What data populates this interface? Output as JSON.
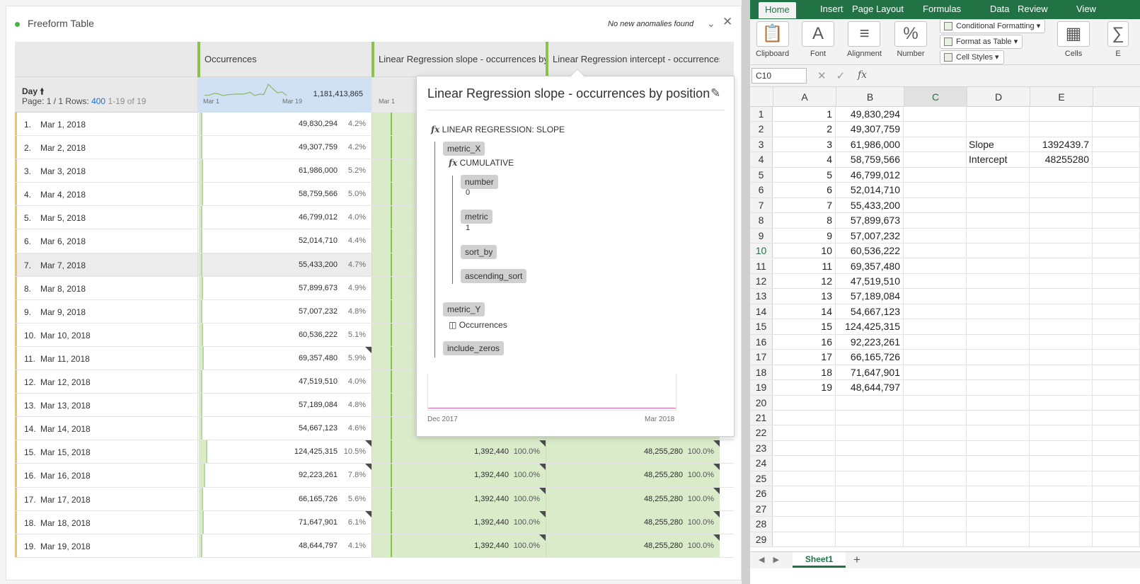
{
  "panel": {
    "title": "Freeform Table",
    "anomaly_text": "No new anomalies found",
    "collapse_icon": "chevron-down-icon",
    "close_icon": "close-icon"
  },
  "table": {
    "columns": [
      "Occurrences",
      "Linear Regression slope - occurrences by p",
      "Linear Regression intercept - occurrences b"
    ],
    "dimension": "Day",
    "sort_icon": "arrow-up-icon",
    "page_prefix": "Page: 1 / 1  Rows:",
    "rows_value": "400",
    "range_text": "1-19 of 19",
    "occ_total": "1,181,413,865",
    "spark_start": "Mar 1",
    "spark_end": "Mar 19",
    "spark2_start": "Mar 1",
    "rows": [
      {
        "idx": "1.",
        "day": "Mar 1, 2018",
        "occ": "49,830,294",
        "pct": "4.2%",
        "share": 4.2
      },
      {
        "idx": "2.",
        "day": "Mar 2, 2018",
        "occ": "49,307,759",
        "pct": "4.2%",
        "share": 4.2
      },
      {
        "idx": "3.",
        "day": "Mar 3, 2018",
        "occ": "61,986,000",
        "pct": "5.2%",
        "share": 5.2
      },
      {
        "idx": "4.",
        "day": "Mar 4, 2018",
        "occ": "58,759,566",
        "pct": "5.0%",
        "share": 5.0
      },
      {
        "idx": "5.",
        "day": "Mar 5, 2018",
        "occ": "46,799,012",
        "pct": "4.0%",
        "share": 4.0
      },
      {
        "idx": "6.",
        "day": "Mar 6, 2018",
        "occ": "52,014,710",
        "pct": "4.4%",
        "share": 4.4
      },
      {
        "idx": "7.",
        "day": "Mar 7, 2018",
        "occ": "55,433,200",
        "pct": "4.7%",
        "share": 4.7
      },
      {
        "idx": "8.",
        "day": "Mar 8, 2018",
        "occ": "57,899,673",
        "pct": "4.9%",
        "share": 4.9
      },
      {
        "idx": "9.",
        "day": "Mar 9, 2018",
        "occ": "57,007,232",
        "pct": "4.8%",
        "share": 4.8
      },
      {
        "idx": "10.",
        "day": "Mar 10, 2018",
        "occ": "60,536,222",
        "pct": "5.1%",
        "share": 5.1
      },
      {
        "idx": "11.",
        "day": "Mar 11, 2018",
        "occ": "69,357,480",
        "pct": "5.9%",
        "share": 5.9
      },
      {
        "idx": "12.",
        "day": "Mar 12, 2018",
        "occ": "47,519,510",
        "pct": "4.0%",
        "share": 4.0
      },
      {
        "idx": "13.",
        "day": "Mar 13, 2018",
        "occ": "57,189,084",
        "pct": "4.8%",
        "share": 4.8
      },
      {
        "idx": "14.",
        "day": "Mar 14, 2018",
        "occ": "54,667,123",
        "pct": "4.6%",
        "share": 4.6
      },
      {
        "idx": "15.",
        "day": "Mar 15, 2018",
        "occ": "124,425,315",
        "pct": "10.5%",
        "share": 10.5,
        "slope": "1,392,440",
        "slope_pct": "100.0%",
        "intercept": "48,255,280",
        "intercept_pct": "100.0%"
      },
      {
        "idx": "16.",
        "day": "Mar 16, 2018",
        "occ": "92,223,261",
        "pct": "7.8%",
        "share": 7.8,
        "slope": "1,392,440",
        "slope_pct": "100.0%",
        "intercept": "48,255,280",
        "intercept_pct": "100.0%"
      },
      {
        "idx": "17.",
        "day": "Mar 17, 2018",
        "occ": "66,165,726",
        "pct": "5.6%",
        "share": 5.6,
        "slope": "1,392,440",
        "slope_pct": "100.0%",
        "intercept": "48,255,280",
        "intercept_pct": "100.0%"
      },
      {
        "idx": "18.",
        "day": "Mar 18, 2018",
        "occ": "71,647,901",
        "pct": "6.1%",
        "share": 6.1,
        "slope": "1,392,440",
        "slope_pct": "100.0%",
        "intercept": "48,255,280",
        "intercept_pct": "100.0%"
      },
      {
        "idx": "19.",
        "day": "Mar 19, 2018",
        "occ": "48,644,797",
        "pct": "4.1%",
        "share": 4.1,
        "slope": "1,392,440",
        "slope_pct": "100.0%",
        "intercept": "48,255,280",
        "intercept_pct": "100.0%"
      }
    ]
  },
  "popover": {
    "title": "Linear Regression slope - occurrences by position",
    "edit_icon": "pencil-icon",
    "fx_symbol": "fx",
    "function_name": "LINEAR REGRESSION: SLOPE",
    "metric_x": "metric_X",
    "cumulative": "CUMULATIVE",
    "number_label": "number",
    "number_value": "0",
    "metric_label": "metric",
    "metric_value": "1",
    "sort_by": "sort_by",
    "ascending_sort": "ascending_sort",
    "metric_y": "metric_Y",
    "metric_icon": "metric-cursor-icon",
    "occurrences": "Occurrences",
    "include_zeros": "include_zeros",
    "chart_start": "Dec 2017",
    "chart_end": "Mar 2018"
  },
  "excel": {
    "tabs": [
      "Home",
      "Insert",
      "Page Layout",
      "Formulas",
      "Data",
      "Review",
      "View"
    ],
    "active_tab": "Home",
    "groups": {
      "clipboard": "Clipboard",
      "font": "Font",
      "alignment": "Alignment",
      "number": "Number",
      "cells": "Cells",
      "editing_partial": "E"
    },
    "styles_buttons": [
      "Conditional Formatting",
      "Format as Table",
      "Cell Styles"
    ],
    "name_box": "C10",
    "fx_label": "fx",
    "column_headers": [
      "A",
      "B",
      "C",
      "D",
      "E"
    ],
    "selected_column": "C",
    "selected_row": "10",
    "rows": [
      {
        "r": "1",
        "a": "1",
        "b": "49,830,294",
        "d": "",
        "e": ""
      },
      {
        "r": "2",
        "a": "2",
        "b": "49,307,759",
        "d": "",
        "e": ""
      },
      {
        "r": "3",
        "a": "3",
        "b": "61,986,000",
        "d": "Slope",
        "e": "1392439.7"
      },
      {
        "r": "4",
        "a": "4",
        "b": "58,759,566",
        "d": "Intercept",
        "e": "48255280"
      },
      {
        "r": "5",
        "a": "5",
        "b": "46,799,012",
        "d": "",
        "e": ""
      },
      {
        "r": "6",
        "a": "6",
        "b": "52,014,710",
        "d": "",
        "e": ""
      },
      {
        "r": "7",
        "a": "7",
        "b": "55,433,200",
        "d": "",
        "e": ""
      },
      {
        "r": "8",
        "a": "8",
        "b": "57,899,673",
        "d": "",
        "e": ""
      },
      {
        "r": "9",
        "a": "9",
        "b": "57,007,232",
        "d": "",
        "e": ""
      },
      {
        "r": "10",
        "a": "10",
        "b": "60,536,222",
        "d": "",
        "e": ""
      },
      {
        "r": "11",
        "a": "11",
        "b": "69,357,480",
        "d": "",
        "e": ""
      },
      {
        "r": "12",
        "a": "12",
        "b": "47,519,510",
        "d": "",
        "e": ""
      },
      {
        "r": "13",
        "a": "13",
        "b": "57,189,084",
        "d": "",
        "e": ""
      },
      {
        "r": "14",
        "a": "14",
        "b": "54,667,123",
        "d": "",
        "e": ""
      },
      {
        "r": "15",
        "a": "15",
        "b": "124,425,315",
        "d": "",
        "e": ""
      },
      {
        "r": "16",
        "a": "16",
        "b": "92,223,261",
        "d": "",
        "e": ""
      },
      {
        "r": "17",
        "a": "17",
        "b": "66,165,726",
        "d": "",
        "e": ""
      },
      {
        "r": "18",
        "a": "18",
        "b": "71,647,901",
        "d": "",
        "e": ""
      },
      {
        "r": "19",
        "a": "19",
        "b": "48,644,797",
        "d": "",
        "e": ""
      },
      {
        "r": "20",
        "a": "",
        "b": "",
        "d": "",
        "e": ""
      },
      {
        "r": "21",
        "a": "",
        "b": "",
        "d": "",
        "e": ""
      },
      {
        "r": "22",
        "a": "",
        "b": "",
        "d": "",
        "e": ""
      },
      {
        "r": "23",
        "a": "",
        "b": "",
        "d": "",
        "e": ""
      },
      {
        "r": "24",
        "a": "",
        "b": "",
        "d": "",
        "e": ""
      },
      {
        "r": "25",
        "a": "",
        "b": "",
        "d": "",
        "e": ""
      },
      {
        "r": "26",
        "a": "",
        "b": "",
        "d": "",
        "e": ""
      },
      {
        "r": "27",
        "a": "",
        "b": "",
        "d": "",
        "e": ""
      },
      {
        "r": "28",
        "a": "",
        "b": "",
        "d": "",
        "e": ""
      },
      {
        "r": "29",
        "a": "",
        "b": "",
        "d": "",
        "e": ""
      }
    ],
    "sheet_tab": "Sheet1",
    "add_sheet": "+"
  },
  "colors": {
    "excel_green": "#217346",
    "metric_green": "#8bc34a",
    "dim_yellow": "#f0c457",
    "bar_fill": "#d7ecc7",
    "link_blue": "#1473e6"
  }
}
